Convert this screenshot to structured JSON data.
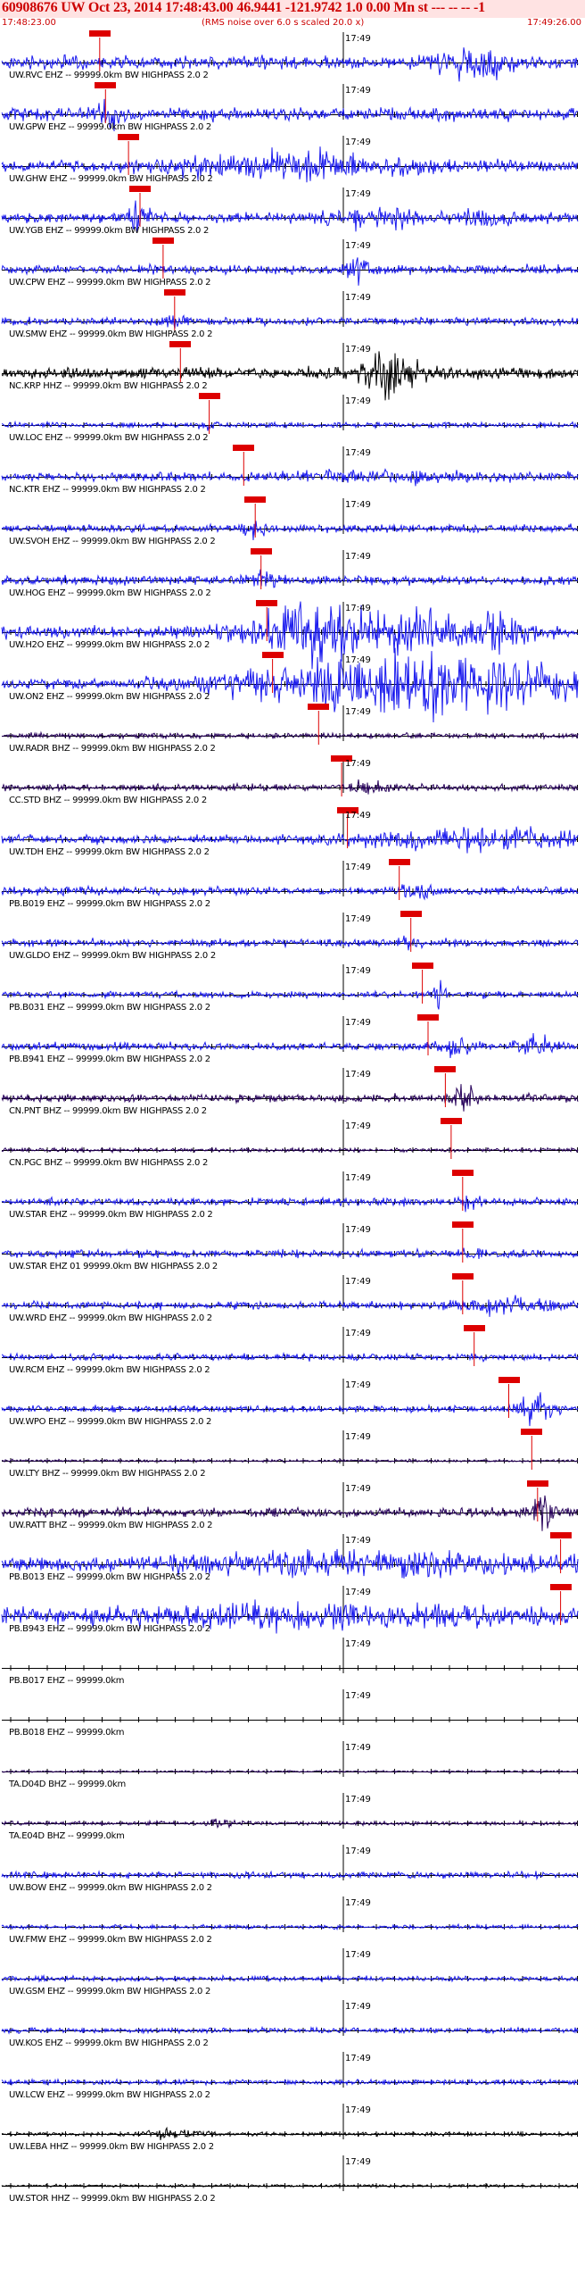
{
  "header": {
    "title": "60908676 UW Oct 23, 2014 17:48:43.00   46.9441 -121.9742   1.0 0.00 Mn st --- -- --   -1",
    "start_time": "17:48:23.00",
    "note": "(RMS noise over 6.0 s scaled 20.0 x)",
    "end_time": "17:49:26.00"
  },
  "time_marker": "17:49",
  "colors": {
    "header_text": "#cc0000",
    "header_bg": "#ffe3e3",
    "pick": "#dd0000",
    "baseline": "#000000"
  },
  "traces": [
    {
      "label": "UW.RVC EHZ -- 99999.0km BW  HIGHPASS  2.0  2",
      "color": "#1a1aee",
      "amp": 10,
      "pick": 0.17,
      "events": [
        [
          0.82,
          0.05,
          2.2
        ]
      ]
    },
    {
      "label": "UW.GPW EHZ -- 99999.0km BW  HIGHPASS  2.0  2",
      "color": "#1a1aee",
      "amp": 10,
      "pick": 0.18,
      "events": [
        [
          0.18,
          0.02,
          2.0
        ]
      ]
    },
    {
      "label": "UW.GHW EHZ -- 99999.0km BW  HIGHPASS  2.0  2",
      "color": "#1a1aee",
      "amp": 9,
      "pick": 0.22,
      "events": [
        [
          0.5,
          0.2,
          1.8
        ]
      ]
    },
    {
      "label": "UW.YGB EHZ -- 99999.0km BW  HIGHPASS  2.0  2",
      "color": "#1a1aee",
      "amp": 8,
      "pick": 0.24,
      "events": [
        [
          0.24,
          0.02,
          2.0
        ],
        [
          0.65,
          0.08,
          1.8
        ],
        [
          0.84,
          0.05,
          1.6
        ]
      ]
    },
    {
      "label": "UW.CPW EHZ -- 99999.0km BW  HIGHPASS  2.0  2",
      "color": "#1a1aee",
      "amp": 7,
      "pick": 0.28,
      "events": [
        [
          0.62,
          0.02,
          2.4
        ]
      ]
    },
    {
      "label": "UW.SMW EHZ -- 99999.0km BW  HIGHPASS  2.0  2",
      "color": "#1a1aee",
      "amp": 6,
      "pick": 0.3,
      "events": [
        [
          0.3,
          0.02,
          1.6
        ]
      ]
    },
    {
      "label": "NC.KRP HHZ -- 99999.0km BW  HIGHPASS  2.0  2",
      "color": "#000000",
      "amp": 9,
      "pick": 0.31,
      "events": [
        [
          0.67,
          0.05,
          2.5
        ]
      ]
    },
    {
      "label": "UW.LOC EHZ -- 99999.0km BW  HIGHPASS  2.0  2",
      "color": "#1a1aee",
      "amp": 4,
      "pick": 0.36,
      "events": [
        [
          0.36,
          0.02,
          1.5
        ]
      ]
    },
    {
      "label": "NC.KTR EHZ -- 99999.0km BW  HIGHPASS  2.0  2",
      "color": "#1a1aee",
      "amp": 6,
      "pick": 0.42,
      "events": [
        [
          0.7,
          0.3,
          1.4
        ]
      ]
    },
    {
      "label": "UW.SVOH EHZ -- 99999.0km BW  HIGHPASS  2.0  2",
      "color": "#1a1aee",
      "amp": 6,
      "pick": 0.44,
      "events": [
        [
          0.44,
          0.02,
          2.0
        ]
      ]
    },
    {
      "label": "UW.HOG EHZ -- 99999.0km BW  HIGHPASS  2.0  2",
      "color": "#1a1aee",
      "amp": 7,
      "pick": 0.45,
      "events": [
        [
          0.45,
          0.02,
          1.6
        ]
      ]
    },
    {
      "label": "UW.H2O EHZ -- 99999.0km BW  HIGHPASS  2.0  2",
      "color": "#1a1aee",
      "amp": 9,
      "pick": 0.46,
      "events": [
        [
          0.55,
          0.12,
          3.0
        ],
        [
          0.73,
          0.06,
          2.4
        ],
        [
          0.86,
          0.06,
          2.2
        ]
      ]
    },
    {
      "label": "UW.ON2 EHZ -- 99999.0km BW  HIGHPASS  2.0  2",
      "color": "#1a1aee",
      "amp": 8,
      "pick": 0.47,
      "events": [
        [
          0.72,
          0.28,
          3.6
        ]
      ]
    },
    {
      "label": "UW.RADR BHZ -- 99999.0km BW  HIGHPASS  2.0  2",
      "color": "#26005a",
      "amp": 4,
      "pick": 0.55,
      "events": []
    },
    {
      "label": "CC.STD BHZ -- 99999.0km BW  HIGHPASS  2.0  2",
      "color": "#26005a",
      "amp": 5,
      "pick": 0.59,
      "events": [
        [
          0.64,
          0.03,
          2.4
        ]
      ]
    },
    {
      "label": "UW.TDH EHZ -- 99999.0km BW  HIGHPASS  2.0  2",
      "color": "#1a1aee",
      "amp": 7,
      "pick": 0.6,
      "events": [
        [
          0.8,
          0.2,
          1.8
        ]
      ]
    },
    {
      "label": "PB.B019 EHZ -- 99999.0km BW  HIGHPASS  2.0  2",
      "color": "#1a1aee",
      "amp": 6,
      "pick": 0.69,
      "events": [
        [
          0.72,
          0.03,
          1.8
        ]
      ]
    },
    {
      "label": "UW.GLDO EHZ -- 99999.0km BW  HIGHPASS  2.0  2",
      "color": "#1a1aee",
      "amp": 6,
      "pick": 0.71,
      "events": [
        [
          0.71,
          0.02,
          1.6
        ]
      ]
    },
    {
      "label": "PB.B031 EHZ -- 99999.0km BW  HIGHPASS  2.0  2",
      "color": "#1a1aee",
      "amp": 5,
      "pick": 0.73,
      "events": [
        [
          0.76,
          0.01,
          3.0
        ]
      ]
    },
    {
      "label": "PB.B941 EHZ -- 99999.0km BW  HIGHPASS  2.0  2",
      "color": "#1a1aee",
      "amp": 6,
      "pick": 0.74,
      "events": [
        [
          0.79,
          0.03,
          2.0
        ],
        [
          0.93,
          0.03,
          2.0
        ]
      ]
    },
    {
      "label": "CN.PNT BHZ -- 99999.0km BW  HIGHPASS  2.0  2",
      "color": "#26005a",
      "amp": 6,
      "pick": 0.77,
      "events": [
        [
          0.8,
          0.02,
          3.0
        ]
      ]
    },
    {
      "label": "CN.PGC BHZ -- 99999.0km BW  HIGHPASS  2.0  2",
      "color": "#26005a",
      "amp": 3,
      "pick": 0.78,
      "events": []
    },
    {
      "label": "UW.STAR EHZ -- 99999.0km BW  HIGHPASS  2.0  2",
      "color": "#1a1aee",
      "amp": 6,
      "pick": 0.8,
      "events": [
        [
          0.81,
          0.02,
          1.7
        ]
      ]
    },
    {
      "label": "UW.STAR EHZ 01 99999.0km BW  HIGHPASS  2.0  2",
      "color": "#1a1aee",
      "amp": 6,
      "pick": 0.8,
      "events": [
        [
          0.82,
          0.02,
          1.6
        ]
      ]
    },
    {
      "label": "UW.WRD EHZ -- 99999.0km BW  HIGHPASS  2.0  2",
      "color": "#1a1aee",
      "amp": 6,
      "pick": 0.8,
      "events": [
        [
          0.88,
          0.1,
          1.7
        ]
      ]
    },
    {
      "label": "UW.RCM EHZ -- 99999.0km BW  HIGHPASS  2.0  2",
      "color": "#1a1aee",
      "amp": 5,
      "pick": 0.82,
      "events": []
    },
    {
      "label": "UW.WPO EHZ -- 99999.0km BW  HIGHPASS  2.0  2",
      "color": "#1a1aee",
      "amp": 5,
      "pick": 0.88,
      "events": [
        [
          0.93,
          0.03,
          2.8
        ]
      ]
    },
    {
      "label": "UW.LTY BHZ -- 99999.0km BW  HIGHPASS  2.0  2",
      "color": "#26005a",
      "amp": 2,
      "pick": 0.92,
      "events": []
    },
    {
      "label": "UW.RATT BHZ -- 99999.0km BW  HIGHPASS  2.0  2",
      "color": "#26005a",
      "amp": 7,
      "pick": 0.93,
      "events": [
        [
          0.94,
          0.02,
          2.6
        ]
      ]
    },
    {
      "label": "PB.B013 EHZ -- 99999.0km BW  HIGHPASS  2.0  2",
      "color": "#1a1aee",
      "amp": 9,
      "pick": 0.97,
      "events": [
        [
          0.6,
          0.35,
          1.8
        ]
      ]
    },
    {
      "label": "PB.B943 EHZ -- 99999.0km BW  HIGHPASS  2.0  2",
      "color": "#1a1aee",
      "amp": 10,
      "pick": 0.97,
      "events": [
        [
          0.5,
          0.45,
          1.5
        ]
      ]
    },
    {
      "label": "PB.B017 EHZ -- 99999.0km",
      "color": "#1a1aee",
      "amp": 0,
      "pick": null,
      "events": []
    },
    {
      "label": "PB.B018 EHZ -- 99999.0km",
      "color": "#1a1aee",
      "amp": 0,
      "pick": null,
      "events": []
    },
    {
      "label": "TA.D04D BHZ -- 99999.0km",
      "color": "#26005a",
      "amp": 1.5,
      "pick": null,
      "events": []
    },
    {
      "label": "TA.E04D BHZ -- 99999.0km",
      "color": "#26005a",
      "amp": 3,
      "pick": null,
      "events": [
        [
          0.38,
          0.02,
          2.0
        ]
      ]
    },
    {
      "label": "UW.BOW EHZ -- 99999.0km BW  HIGHPASS  2.0  2",
      "color": "#1a1aee",
      "amp": 5,
      "pick": null,
      "events": []
    },
    {
      "label": "UW.FMW EHZ -- 99999.0km BW  HIGHPASS  2.0  2",
      "color": "#1a1aee",
      "amp": 3,
      "pick": null,
      "events": []
    },
    {
      "label": "UW.GSM EHZ -- 99999.0km BW  HIGHPASS  2.0  2",
      "color": "#1a1aee",
      "amp": 4,
      "pick": null,
      "events": []
    },
    {
      "label": "UW.KOS EHZ -- 99999.0km BW  HIGHPASS  2.0  2",
      "color": "#1a1aee",
      "amp": 4,
      "pick": null,
      "events": []
    },
    {
      "label": "UW.LCW EHZ -- 99999.0km BW  HIGHPASS  2.0  2",
      "color": "#1a1aee",
      "amp": 4,
      "pick": null,
      "events": []
    },
    {
      "label": "UW.LEBA HHZ -- 99999.0km BW  HIGHPASS  2.0  2",
      "color": "#000000",
      "amp": 3,
      "pick": null,
      "events": [
        [
          0.3,
          0.05,
          2.0
        ]
      ]
    },
    {
      "label": "UW.STOR HHZ -- 99999.0km BW  HIGHPASS  2.0  2",
      "color": "#000000",
      "amp": 2,
      "pick": null,
      "events": []
    }
  ]
}
